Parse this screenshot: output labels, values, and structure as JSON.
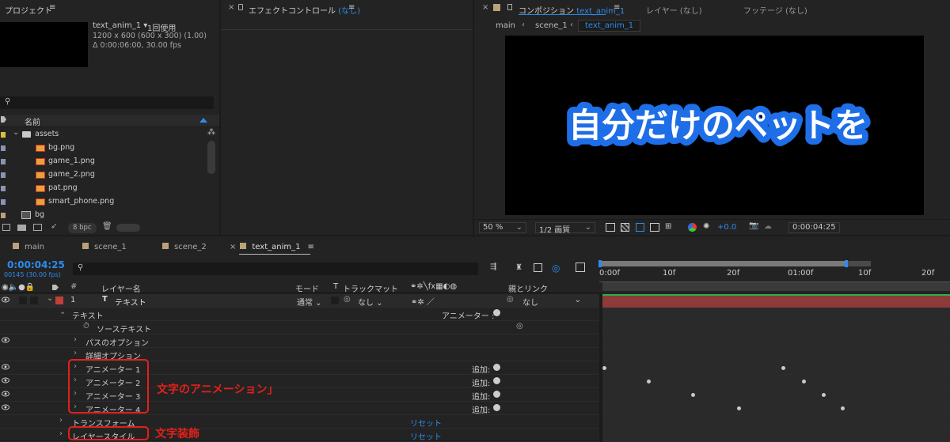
{
  "project": {
    "title": "プロジェクト",
    "comp_name": "text_anim_1 ▾",
    "usage": "1回使用",
    "resolution": "1200 x 600  (600 x 300) (1.00)",
    "duration": "Δ 0:00:06:00, 30.00 fps",
    "col_name": "名前",
    "items": [
      {
        "label": "assets",
        "type": "folder"
      },
      {
        "label": "bg.png",
        "type": "image"
      },
      {
        "label": "game_1.png",
        "type": "image"
      },
      {
        "label": "game_2.png",
        "type": "image"
      },
      {
        "label": "pat.png",
        "type": "image"
      },
      {
        "label": "smart_phone.png",
        "type": "image"
      },
      {
        "label": "bg",
        "type": "comp"
      }
    ],
    "bpc": "8 bpc"
  },
  "effects": {
    "title": "エフェクトコントロール",
    "title_value": "(なし)"
  },
  "composition": {
    "title": "コンポジション",
    "title_value": "text_anim_1",
    "layer_tab": "レイヤー (なし)",
    "footage_tab": "フッテージ (なし)",
    "breadcrumbs": [
      "main",
      "scene_1",
      "text_anim_1"
    ],
    "viewer_text": "自分だけのペットを",
    "zoom": "50 %",
    "resolution": "1/2 画質",
    "exposure": "+0.0",
    "timecode": "0:00:04:25"
  },
  "timeline": {
    "tabs": [
      "main",
      "scene_1",
      "scene_2",
      "text_anim_1"
    ],
    "timecode": "0:00:04:25",
    "frame_info": "00145 (30.00 fps)",
    "headers": {
      "layer_name": "レイヤー名",
      "mode": "モード",
      "t": "T",
      "track_matte": "トラックマット",
      "parent": "親とリンク",
      "num": "#"
    },
    "ruler": [
      "0:00f",
      "10f",
      "20f",
      "01:00f",
      "10f",
      "20f"
    ],
    "layer": {
      "num": "1",
      "type": "T",
      "name": "テキスト",
      "mode": "通常",
      "matte": "なし",
      "parent": "なし"
    },
    "rows": {
      "text": "テキスト",
      "animator_label": "アニメーター :",
      "source_text": "ソーステキスト",
      "path_options": "パスのオプション",
      "more_options": "詳細オプション",
      "animators": [
        "アニメーター 1",
        "アニメーター 2",
        "アニメーター 3",
        "アニメーター 4"
      ],
      "add": "追加:",
      "transform": "トランスフォーム",
      "layer_styles": "レイヤースタイル",
      "reset": "リセット"
    }
  },
  "annotations": {
    "animators": "文字のアニメーション」",
    "styles": "文字装飾"
  },
  "colors": {
    "accent": "#2d8ceb",
    "label_red": "#c0403a",
    "layer_bar": "#8e3a3a",
    "annotation": "#e3201b"
  }
}
